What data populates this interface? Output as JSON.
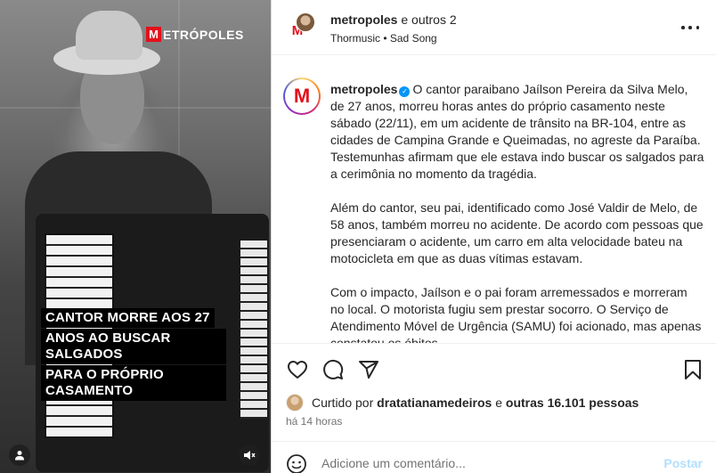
{
  "media": {
    "logo_mark": "M",
    "logo_text": "ETRÓPOLES",
    "caption_lines": [
      "CANTOR MORRE AOS 27",
      "ANOS AO BUSCAR SALGADOS",
      "PARA O PRÓPRIO CASAMENTO"
    ],
    "tag_icon": "user-tag-icon",
    "mute_icon": "speaker-muted-icon"
  },
  "header": {
    "username": "metropoles",
    "collab_suffix": "e outros 2",
    "audio": "Thormusic • Sad Song",
    "more_icon": "more-horizontal-icon"
  },
  "caption": {
    "avatar_mark": "M",
    "username": "metropoles",
    "paragraphs": [
      "O cantor paraibano Jaílson Pereira da Silva Melo, de 27 anos, morreu horas antes do próprio casamento neste sábado (22/11), em um acidente de trânsito na BR-104, entre as cidades de Campina Grande e Queimadas, no agreste da Paraíba. Testemunhas afirmam que ele estava indo buscar os salgados para a cerimônia no momento da tragédia.",
      "Além do cantor, seu pai, identificado como José Valdir de Melo, de 58 anos, também morreu no acidente. De acordo com pessoas que presenciaram o acidente, um carro em alta velocidade bateu na motocicleta em que as duas vítimas estavam.",
      "Com o impacto, Jaílson e o pai foram arremessados e morreram no local. O motorista fugiu sem prestar socorro. O Serviço de Atendimento Móvel de Urgência (SAMU) foi acionado, mas apenas constatou os óbitos."
    ]
  },
  "actions": {
    "like_icon": "heart-icon",
    "comment_icon": "comment-icon",
    "share_icon": "paper-plane-icon",
    "save_icon": "bookmark-icon"
  },
  "likes": {
    "prefix": "Curtido por",
    "user": "dratatianamedeiros",
    "connector": "e",
    "others": "outras 16.101 pessoas"
  },
  "timestamp": "há 14 horas",
  "comment": {
    "placeholder": "Adicione um comentário...",
    "post_label": "Postar",
    "emoji_icon": "smiley-icon"
  },
  "colors": {
    "brand_red": "#e3101b",
    "verified_blue": "#0095f6",
    "post_button": "#b2dffc"
  }
}
